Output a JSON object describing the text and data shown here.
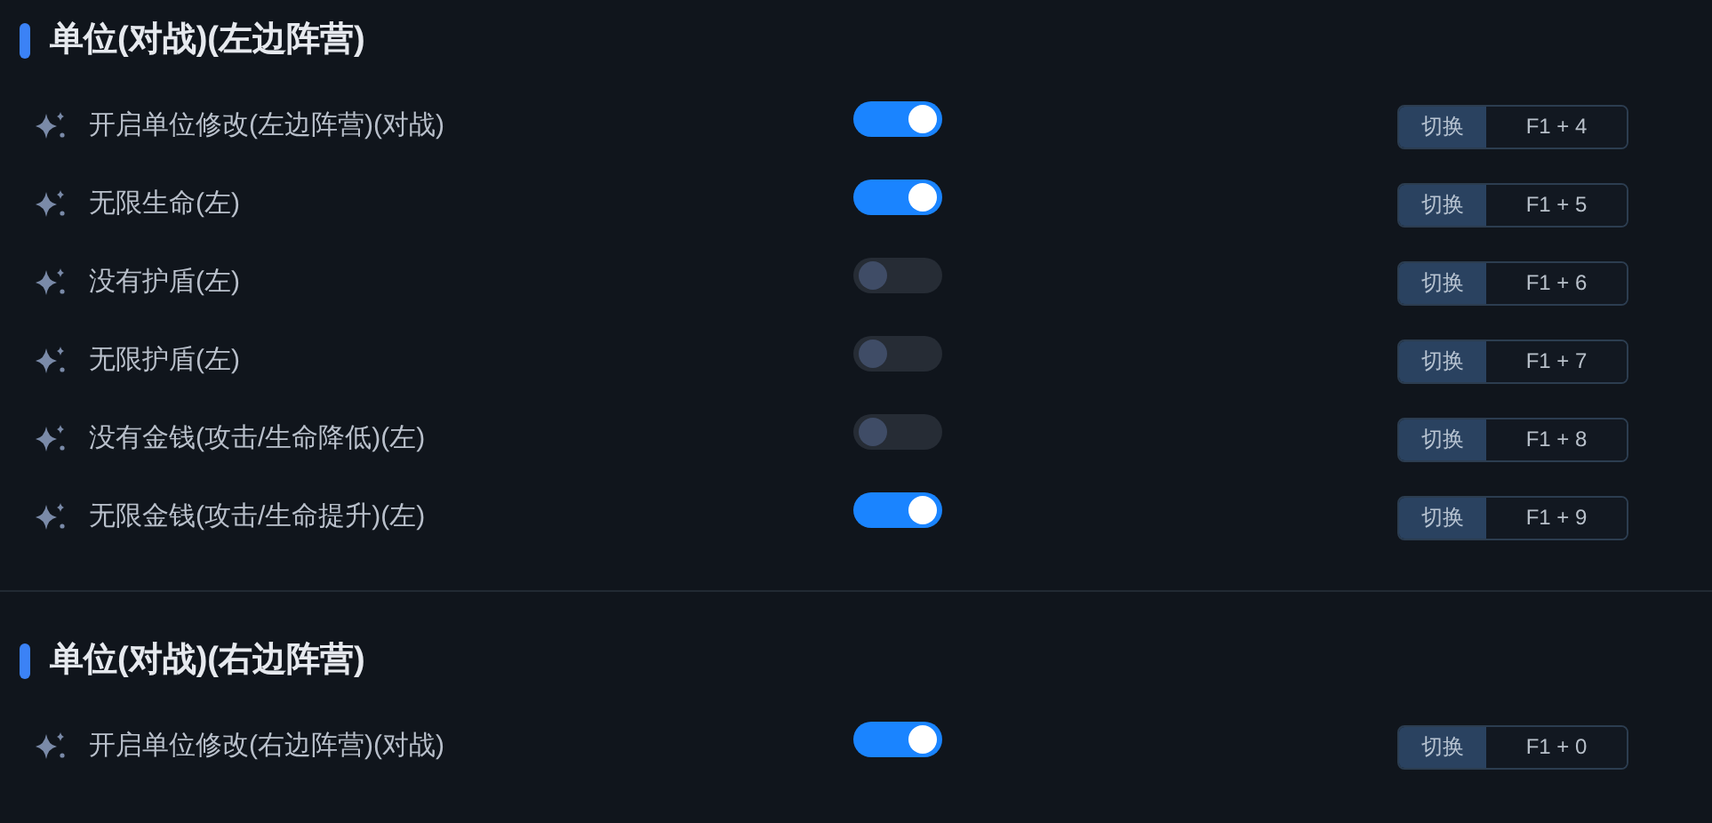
{
  "sections": [
    {
      "title": "单位(对战)(左边阵营)",
      "rows": [
        {
          "label": "开启单位修改(左边阵营)(对战)",
          "on": true,
          "action": "切换",
          "hotkey": "F1 + 4"
        },
        {
          "label": "无限生命(左)",
          "on": true,
          "action": "切换",
          "hotkey": "F1 + 5"
        },
        {
          "label": "没有护盾(左)",
          "on": false,
          "action": "切换",
          "hotkey": "F1 + 6"
        },
        {
          "label": "无限护盾(左)",
          "on": false,
          "action": "切换",
          "hotkey": "F1 + 7"
        },
        {
          "label": "没有金钱(攻击/生命降低)(左)",
          "on": false,
          "action": "切换",
          "hotkey": "F1 + 8"
        },
        {
          "label": "无限金钱(攻击/生命提升)(左)",
          "on": true,
          "action": "切换",
          "hotkey": "F1 + 9"
        }
      ]
    },
    {
      "title": "单位(对战)(右边阵营)",
      "rows": [
        {
          "label": "开启单位修改(右边阵营)(对战)",
          "on": true,
          "action": "切换",
          "hotkey": "F1 + 0"
        }
      ]
    }
  ]
}
